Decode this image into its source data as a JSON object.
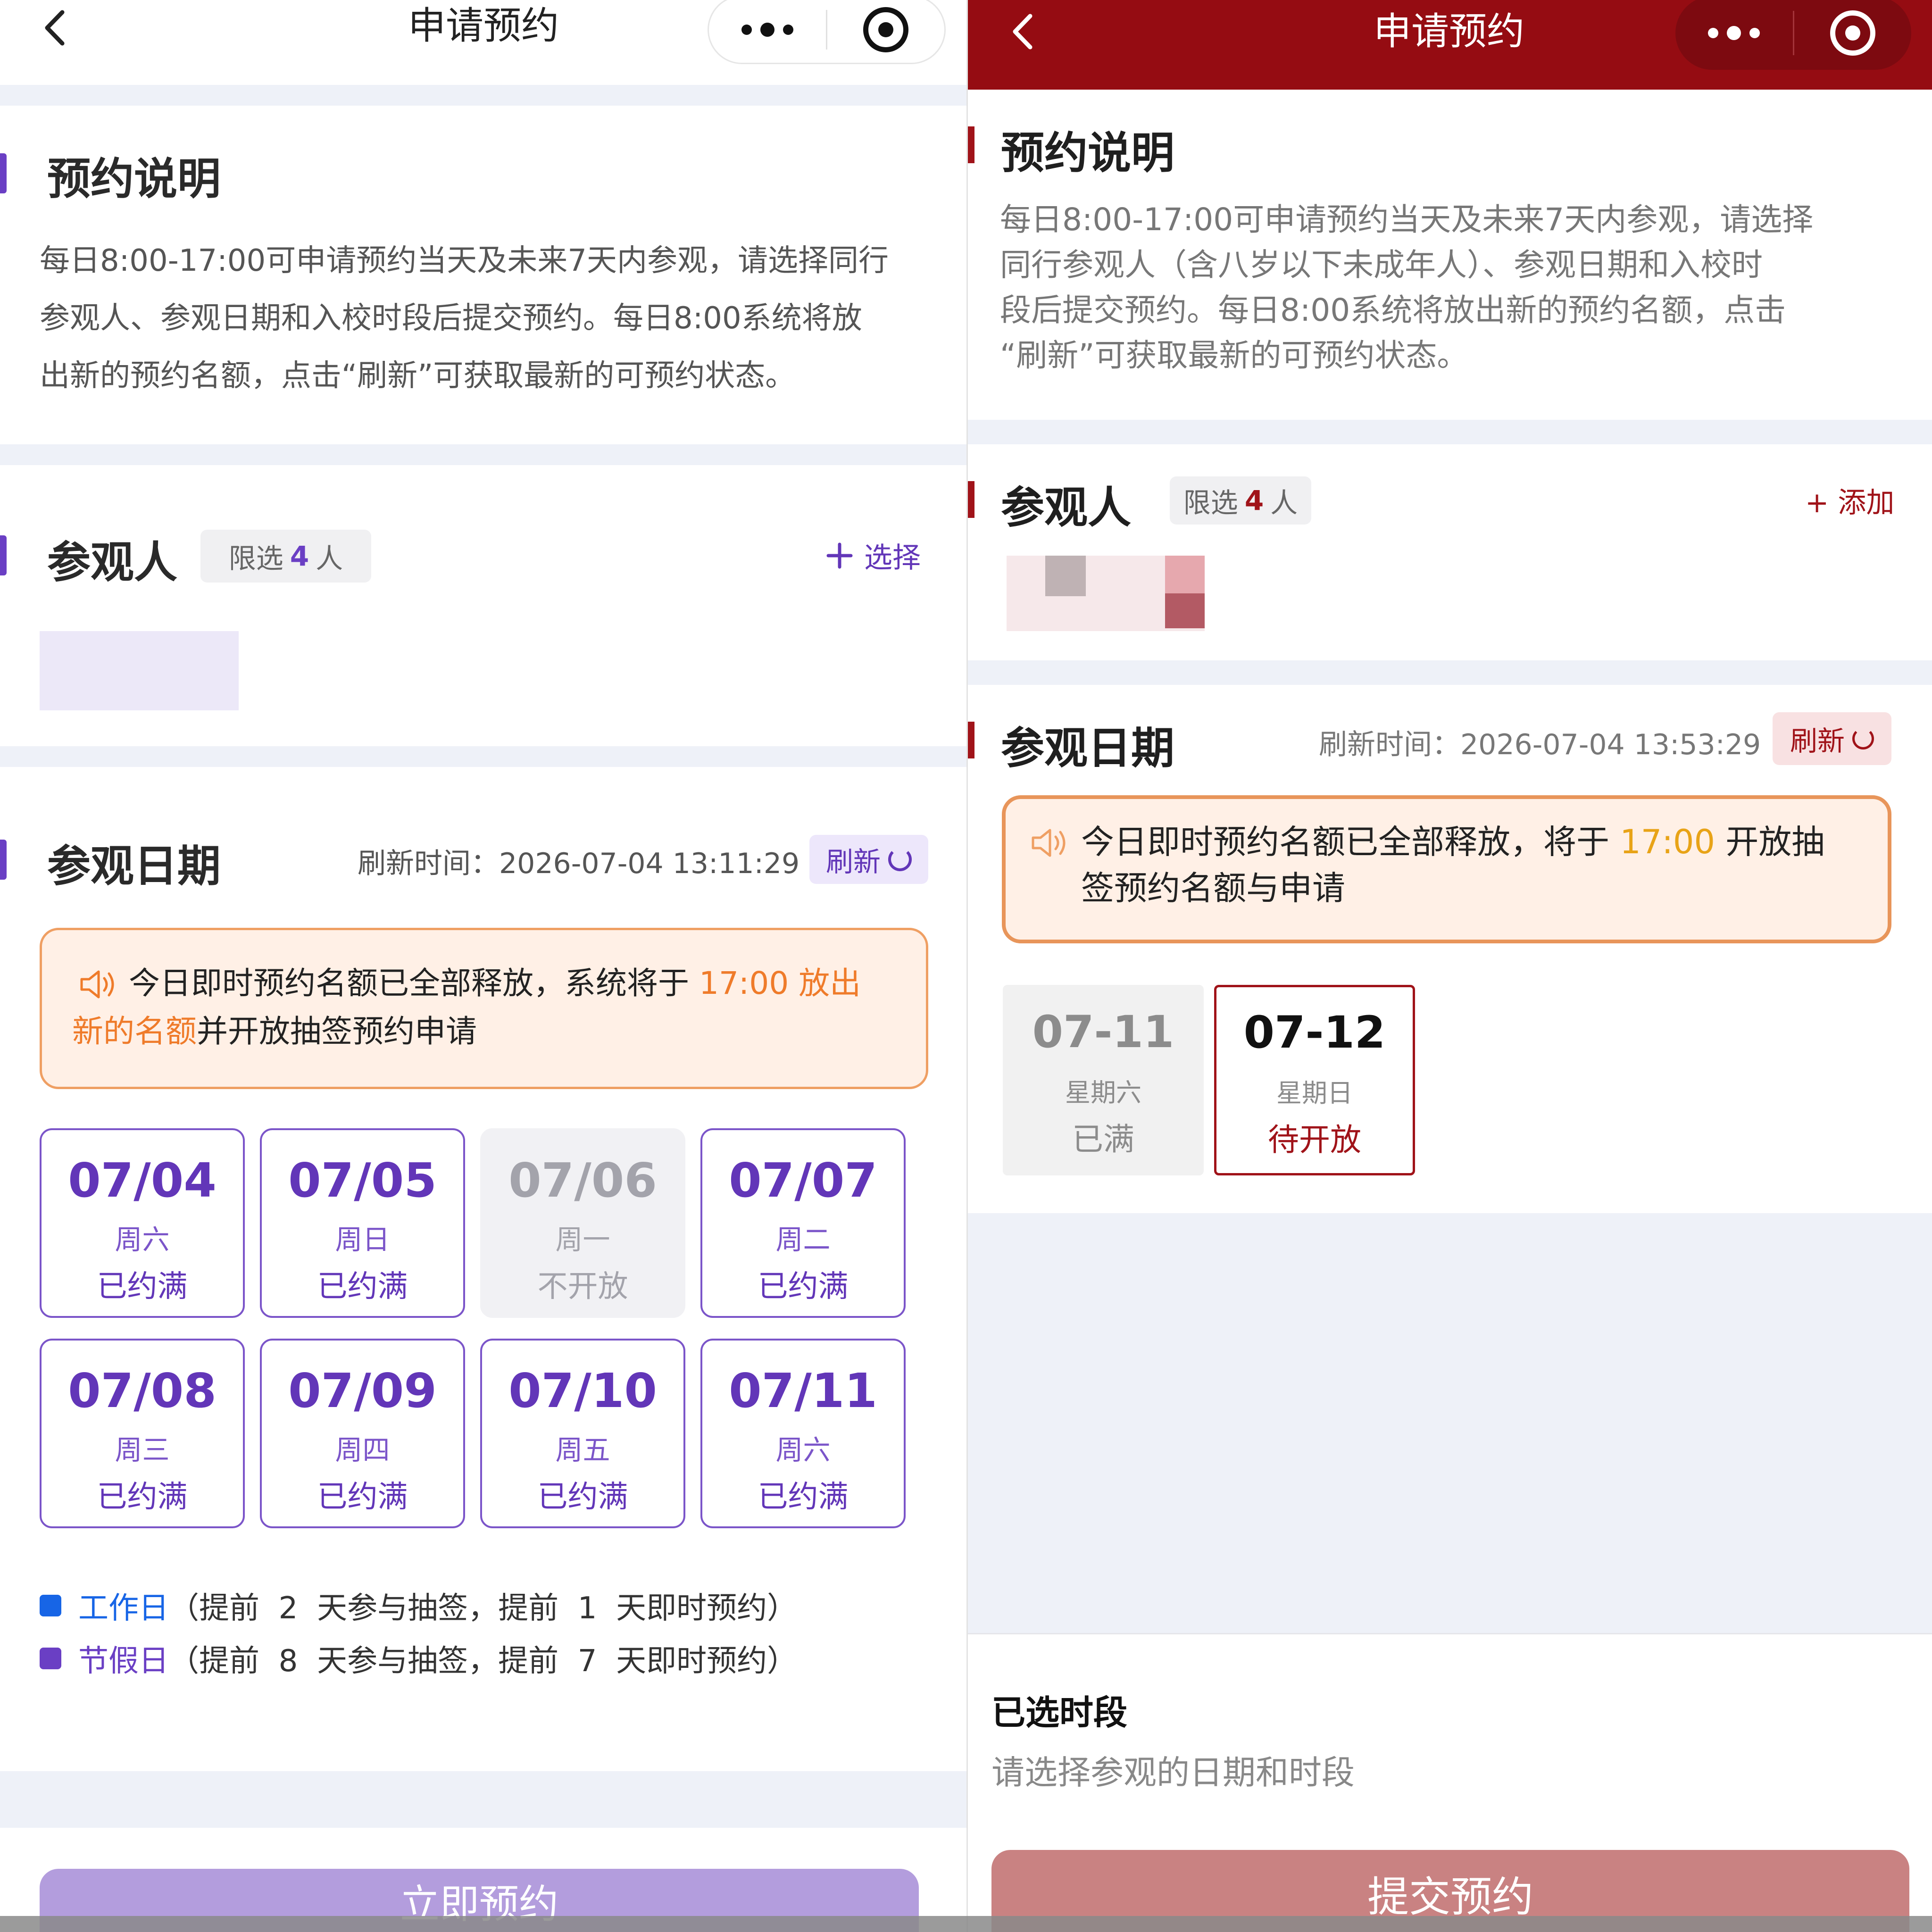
{
  "left": {
    "nav": {
      "title": "申请预约"
    },
    "intro": {
      "title": "预约说明",
      "lines": [
        "每日8:00-17:00可申请预约当天及未来7天内参观，请选择同行",
        "参观人、参观日期和入校时段后提交预约。每日8:00系统将放",
        "出新的预约名额，点击“刷新”可获取最新的可预约状态。"
      ]
    },
    "visitors": {
      "title": "参观人",
      "limit_prefix": "限选",
      "limit_count": "4",
      "limit_suffix": "人",
      "add_label": "选择"
    },
    "dates": {
      "title": "参观日期",
      "refresh_time": "刷新时间：2026-07-04 13:11:29",
      "refresh_label": "刷新",
      "notice": {
        "part1": "今日即时预约名额已全部释放，系统将于 ",
        "highlight1": "17:00 放出",
        "highlight2": "新的名额",
        "part2": "并开放抽签预约申请"
      },
      "cards": [
        {
          "date": "07/04",
          "weekday": "周六",
          "status": "已约满"
        },
        {
          "date": "07/05",
          "weekday": "周日",
          "status": "已约满"
        },
        {
          "date": "07/06",
          "weekday": "周一",
          "status": "不开放"
        },
        {
          "date": "07/07",
          "weekday": "周二",
          "status": "已约满"
        },
        {
          "date": "07/08",
          "weekday": "周三",
          "status": "已约满"
        },
        {
          "date": "07/09",
          "weekday": "周四",
          "status": "已约满"
        },
        {
          "date": "07/10",
          "weekday": "周五",
          "status": "已约满"
        },
        {
          "date": "07/11",
          "weekday": "周六",
          "status": "已约满"
        }
      ],
      "legend": [
        {
          "name": "工作日",
          "text": "（提前  2  天参与抽签，提前  1  天即时预约）"
        },
        {
          "name": "节假日",
          "text": "（提前  8  天参与抽签，提前  7  天即时预约）"
        }
      ]
    },
    "submit_label": "立即预约"
  },
  "right": {
    "nav": {
      "title": "申请预约"
    },
    "intro": {
      "title": "预约说明",
      "lines": [
        "每日8:00-17:00可申请预约当天及未来7天内参观，请选择",
        "同行参观人（含八岁以下未成年人）、参观日期和入校时",
        "段后提交预约。每日8:00系统将放出新的预约名额，点击",
        "“刷新”可获取最新的可预约状态。"
      ]
    },
    "visitors": {
      "title": "参观人",
      "limit_prefix": "限选",
      "limit_count": "4",
      "limit_suffix": "人",
      "add_label": "+ 添加"
    },
    "dates": {
      "title": "参观日期",
      "refresh_time": "刷新时间：2026-07-04 13:53:29",
      "refresh_label": "刷新",
      "notice": {
        "part1": "今日即时预约名额已全部释放，将于 ",
        "highlight": "17:00",
        "part2": " 开放抽",
        "line2": "签预约名额与申请"
      },
      "cards": [
        {
          "date": "07-11",
          "weekday": "星期六",
          "status": "已满"
        },
        {
          "date": "07-12",
          "weekday": "星期日",
          "status": "待开放"
        }
      ]
    },
    "selected": {
      "title": "已选时段",
      "placeholder": "请选择参观的日期和时段"
    },
    "submit_label": "提交预约"
  },
  "colors": {
    "left_accent": "#6a3fc4",
    "left_date": "#6236b8",
    "left_button": "#b39ddd",
    "right_header": "#950c12",
    "right_accent": "#a01319",
    "right_button": "#c98282",
    "notice_border_left": "#ef9f63",
    "notice_bg": "#fff0e6",
    "orange_text": "#ef7b2a",
    "gold_text": "#e8a317",
    "legend_blue": "#1765e6",
    "legend_purple": "#6a3fc4"
  }
}
